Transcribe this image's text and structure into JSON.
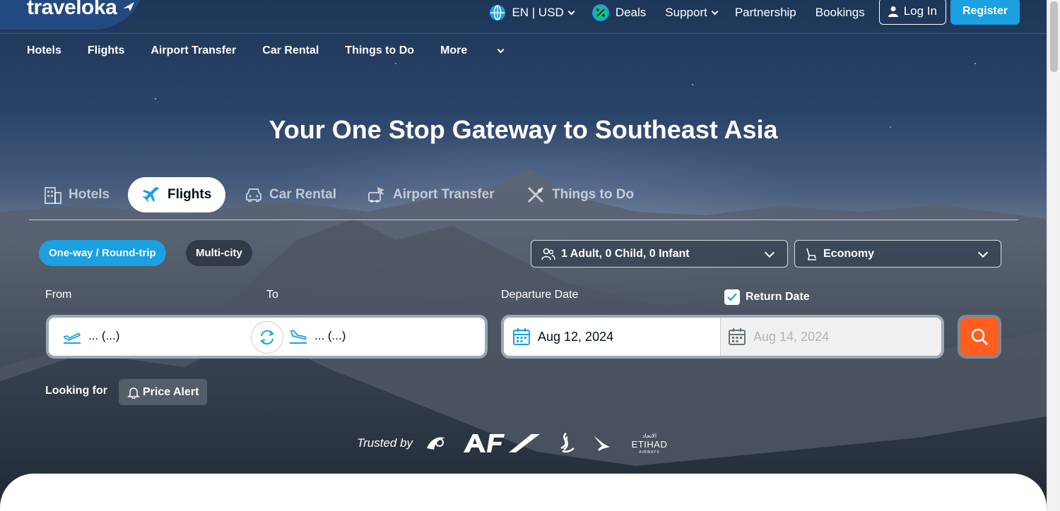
{
  "brand": {
    "name": "traveloka"
  },
  "header": {
    "language_currency": "EN | USD",
    "deals": "Deals",
    "support": "Support",
    "partnership": "Partnership",
    "bookings": "Bookings",
    "login": "Log In",
    "register": "Register"
  },
  "subnav": [
    "Hotels",
    "Flights",
    "Airport Transfer",
    "Car Rental",
    "Things to Do",
    "More"
  ],
  "hero": {
    "title": "Your One Stop Gateway to Southeast Asia"
  },
  "product_tabs": [
    {
      "label": "Hotels",
      "icon": "hotel-icon",
      "active": false
    },
    {
      "label": "Flights",
      "icon": "plane-icon",
      "active": true
    },
    {
      "label": "Car Rental",
      "icon": "car-icon",
      "active": false
    },
    {
      "label": "Airport Transfer",
      "icon": "airport-transfer-icon",
      "active": false
    },
    {
      "label": "Things to Do",
      "icon": "things-to-do-icon",
      "active": false
    }
  ],
  "search": {
    "trip_type_active": "One-way / Round-trip",
    "trip_type_multi": "Multi-city",
    "passengers": "1 Adult, 0 Child, 0 Infant",
    "seat_class": "Economy",
    "from_label": "From",
    "to_label": "To",
    "from_value": "... (...)",
    "to_value": "... (...)",
    "departure_label": "Departure Date",
    "departure_value": "Aug 12, 2024",
    "return_label": "Return Date",
    "return_value": "Aug 14, 2024",
    "return_checked": true
  },
  "looking_for": {
    "label": "Looking for",
    "price_alert": "Price Alert"
  },
  "trusted": {
    "label": "Trusted by",
    "airlines": [
      "Qatar Airways",
      "AF",
      "Singapore Airlines",
      "Cathay Pacific",
      "Etihad Airways"
    ]
  },
  "colors": {
    "accent": "#1BA0E2",
    "search_button": "#FF5E1F",
    "text_dark": "#03121A"
  }
}
